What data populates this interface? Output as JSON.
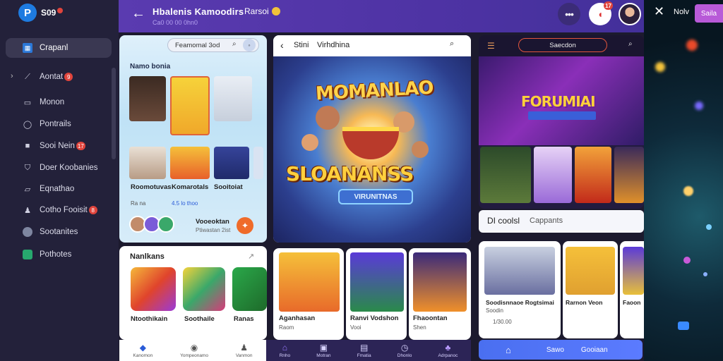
{
  "sidebar": {
    "logo_text": "S09",
    "items": [
      {
        "label": "Crapanl",
        "icon": "grid-icon",
        "active": true
      },
      {
        "label": "Aontat",
        "icon": "chart-icon",
        "badge": "9"
      },
      {
        "label": "Monon",
        "icon": "inbox-icon"
      },
      {
        "label": "Pontrails",
        "icon": "compass-icon"
      },
      {
        "label": "Sooi Nein",
        "icon": "bag-icon",
        "badge": "17"
      },
      {
        "label": "Doer Koobanies",
        "icon": "shield-icon"
      },
      {
        "label": "Eqnathao",
        "icon": "image-icon"
      },
      {
        "label": "Cotho Fooisit",
        "icon": "user-icon",
        "badge": "8"
      },
      {
        "label": "Sootanites",
        "icon": "avatar-icon"
      },
      {
        "label": "Pothotes",
        "icon": "leaf-icon"
      }
    ]
  },
  "topbar": {
    "title": "Hbalenis Kamoodirs",
    "subtitle": "Ca0 00 00 0hn0",
    "side_label": "Rarsoi",
    "notif_badge": "17"
  },
  "panel_a": {
    "search_placeholder": "Feamomal 3od",
    "heading": "Namo bonia",
    "cards": [
      {
        "label": "Roomotuvas",
        "meta": "Ra na"
      },
      {
        "label": "Komarotals",
        "meta": "4.5 lo thoo"
      },
      {
        "label": "Sooitoiat",
        "meta": ""
      }
    ],
    "chip_title": "Vooeoktan",
    "chip_sub": "Ptiwastan 2ist"
  },
  "panel_b": {
    "bar_title": "Stini",
    "bar_title2": "Virhdhina",
    "hero_title": "MOMANLAO",
    "hero_big": "SLOANANSS",
    "hero_sub": "VIRUNITNAS"
  },
  "panel_c": {
    "pill_label": "Saecdon",
    "logo": "FORUMIAI"
  },
  "panel_d": {
    "heading": "Nanlkans",
    "people": [
      {
        "label": "Ntoothikain"
      },
      {
        "label": "Soothaile"
      },
      {
        "label": "Ranas"
      }
    ]
  },
  "bottom_cards": [
    {
      "title": "Aganhasan",
      "sub": "Raom"
    },
    {
      "title": "Ranvi Vodshon",
      "sub": "Vooi"
    },
    {
      "title": "Fhaoontan",
      "sub": "Shen"
    }
  ],
  "panel_e": {
    "title": "DI coolsl",
    "title2": "Cappants",
    "cards": [
      {
        "title": "Soodisnnaoe Rogtsimai",
        "sub": "Soodin",
        "meta": "1/30.00"
      },
      {
        "title": "Rarnon Veon",
        "sub": ""
      },
      {
        "title": "Faoon",
        "sub": ""
      }
    ]
  },
  "bottom_nav_left": [
    "Kanomon",
    "Yompeonamo",
    "Vanmon"
  ],
  "bottom_nav_mid": [
    "Rnho",
    "Motran",
    "Fmatia",
    "Dhonlo",
    "Adrpanoc"
  ],
  "bottom_bar": {
    "label1": "Sawo",
    "label2": "Gooiaan"
  },
  "right_strip": {
    "close_label": "Nolv",
    "button_label": "Saila"
  },
  "colors": {
    "accent": "#5a3bb0",
    "sidebar": "#23213a",
    "brand_blue": "#1e7be0",
    "badge_red": "#e0443c"
  }
}
